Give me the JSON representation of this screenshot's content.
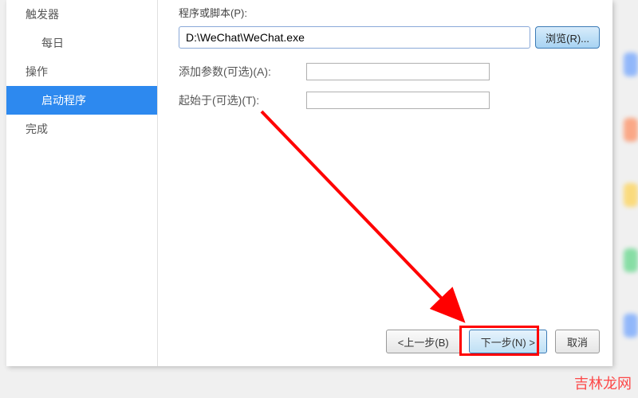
{
  "sidebar": {
    "items": [
      {
        "label": "触发器"
      },
      {
        "label": "每日"
      },
      {
        "label": "操作"
      },
      {
        "label": "启动程序"
      },
      {
        "label": "完成"
      }
    ]
  },
  "form": {
    "path_label": "程序或脚本(P):",
    "path_value": "D:\\WeChat\\WeChat.exe",
    "browse_label": "浏览(R)...",
    "args_label": "添加参数(可选)(A):",
    "args_value": "",
    "startin_label": "起始于(可选)(T):",
    "startin_value": ""
  },
  "wizard": {
    "back_label": "<上一步(B)",
    "next_label": "下一步(N) >",
    "cancel_label": "取消"
  },
  "watermark": "吉林龙网"
}
